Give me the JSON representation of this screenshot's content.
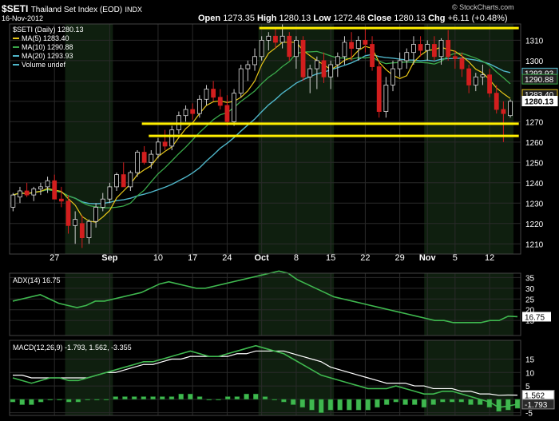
{
  "header": {
    "symbol": "$SETI",
    "name": "Thailand Set Index (EOD)",
    "type": "INDX",
    "date": "16-Nov-2012",
    "open_label": "Open",
    "open": "1273.35",
    "high_label": "High",
    "high": "1280.13",
    "low_label": "Low",
    "low": "1272.48",
    "close_label": "Close",
    "close": "1280.13",
    "chg_label": "Chg",
    "chg": "+6.11 (+0.48%)",
    "watermark": "© StockCharts.com"
  },
  "colors": {
    "up": "#2db84a",
    "down": "#d21e1e",
    "ma5": "#e6c619",
    "ma10": "#3aa84a",
    "ma20": "#4fb6c9",
    "trendline": "#ffef00",
    "adx": "#3fb84f",
    "macd": "#3fb84f",
    "signal": "#ffffff",
    "hist": "#3fb84f",
    "grid": "#2a2a2a",
    "shade": "#0f1f0f"
  },
  "chart_data": [
    {
      "type": "candlestick",
      "title": "$SETI (Daily) 1280.13",
      "legend": [
        {
          "name": "MA(5) 1283.40",
          "color": "ma5"
        },
        {
          "name": "MA(10) 1290.88",
          "color": "ma10"
        },
        {
          "name": "MA(20) 1293.93",
          "color": "ma20"
        },
        {
          "name": "Volume undef",
          "color": "ma20"
        }
      ],
      "legend_position": "top-left",
      "grid": true,
      "ylim": [
        1205,
        1318
      ],
      "yticks": [
        1210,
        1220,
        1230,
        1240,
        1250,
        1260,
        1270,
        1280,
        1290,
        1300,
        1310
      ],
      "price_labels": [
        "1293.93",
        "1290.88",
        "1283.40",
        "1280.13"
      ],
      "xticks": [
        {
          "label": "27",
          "i": 6
        },
        {
          "label": "Sep",
          "i": 14
        },
        {
          "label": "10",
          "i": 21
        },
        {
          "label": "17",
          "i": 26
        },
        {
          "label": "24",
          "i": 31
        },
        {
          "label": "Oct",
          "i": 36
        },
        {
          "label": "8",
          "i": 41
        },
        {
          "label": "15",
          "i": 46
        },
        {
          "label": "22",
          "i": 51
        },
        {
          "label": "29",
          "i": 56
        },
        {
          "label": "Nov",
          "i": 60
        },
        {
          "label": "5",
          "i": 64
        },
        {
          "label": "12",
          "i": 69
        }
      ],
      "shade_ranges": [
        [
          8,
          14
        ],
        [
          36,
          46
        ],
        [
          60,
          72
        ]
      ],
      "n": 74,
      "ohlc": [
        [
          1228,
          1235,
          1226,
          1234
        ],
        [
          1233,
          1238,
          1230,
          1236
        ],
        [
          1236,
          1240,
          1233,
          1234
        ],
        [
          1234,
          1238,
          1231,
          1237
        ],
        [
          1237,
          1240,
          1234,
          1238
        ],
        [
          1238,
          1243,
          1235,
          1241
        ],
        [
          1241,
          1244,
          1236,
          1232
        ],
        [
          1232,
          1238,
          1228,
          1231
        ],
        [
          1231,
          1234,
          1215,
          1219
        ],
        [
          1219,
          1226,
          1210,
          1222
        ],
        [
          1220,
          1224,
          1208,
          1213
        ],
        [
          1213,
          1222,
          1210,
          1221
        ],
        [
          1221,
          1230,
          1218,
          1228
        ],
        [
          1228,
          1235,
          1226,
          1232
        ],
        [
          1232,
          1240,
          1230,
          1238
        ],
        [
          1238,
          1245,
          1236,
          1244
        ],
        [
          1244,
          1250,
          1240,
          1238
        ],
        [
          1238,
          1246,
          1236,
          1245
        ],
        [
          1245,
          1256,
          1243,
          1255
        ],
        [
          1255,
          1258,
          1249,
          1250
        ],
        [
          1250,
          1256,
          1247,
          1254
        ],
        [
          1254,
          1262,
          1252,
          1260
        ],
        [
          1260,
          1266,
          1256,
          1258
        ],
        [
          1258,
          1268,
          1256,
          1266
        ],
        [
          1266,
          1275,
          1264,
          1273
        ],
        [
          1273,
          1278,
          1270,
          1276
        ],
        [
          1276,
          1279,
          1271,
          1274
        ],
        [
          1274,
          1283,
          1272,
          1281
        ],
        [
          1281,
          1288,
          1278,
          1286
        ],
        [
          1286,
          1290,
          1280,
          1282
        ],
        [
          1282,
          1286,
          1276,
          1278
        ],
        [
          1278,
          1283,
          1268,
          1270
        ],
        [
          1270,
          1286,
          1268,
          1284
        ],
        [
          1284,
          1298,
          1282,
          1296
        ],
        [
          1296,
          1300,
          1290,
          1298
        ],
        [
          1298,
          1306,
          1295,
          1302
        ],
        [
          1302,
          1312,
          1300,
          1310
        ],
        [
          1310,
          1314,
          1305,
          1312
        ],
        [
          1312,
          1316,
          1306,
          1309
        ],
        [
          1309,
          1318,
          1306,
          1312
        ],
        [
          1312,
          1314,
          1300,
          1302
        ],
        [
          1302,
          1312,
          1296,
          1310
        ],
        [
          1310,
          1312,
          1290,
          1292
        ],
        [
          1292,
          1298,
          1284,
          1296
        ],
        [
          1296,
          1302,
          1286,
          1300
        ],
        [
          1300,
          1304,
          1289,
          1292
        ],
        [
          1292,
          1300,
          1286,
          1298
        ],
        [
          1298,
          1304,
          1292,
          1302
        ],
        [
          1302,
          1312,
          1298,
          1309
        ],
        [
          1309,
          1314,
          1300,
          1306
        ],
        [
          1306,
          1312,
          1300,
          1310
        ],
        [
          1310,
          1316,
          1304,
          1308
        ],
        [
          1308,
          1312,
          1295,
          1297
        ],
        [
          1297,
          1300,
          1272,
          1275
        ],
        [
          1275,
          1292,
          1272,
          1288
        ],
        [
          1288,
          1300,
          1285,
          1296
        ],
        [
          1296,
          1304,
          1292,
          1300
        ],
        [
          1300,
          1306,
          1296,
          1304
        ],
        [
          1304,
          1312,
          1298,
          1308
        ],
        [
          1308,
          1312,
          1302,
          1305
        ],
        [
          1305,
          1310,
          1300,
          1308
        ],
        [
          1308,
          1312,
          1300,
          1302
        ],
        [
          1302,
          1311,
          1298,
          1310
        ],
        [
          1310,
          1315,
          1300,
          1302
        ],
        [
          1302,
          1305,
          1296,
          1301
        ],
        [
          1301,
          1304,
          1292,
          1296
        ],
        [
          1296,
          1298,
          1284,
          1288
        ],
        [
          1288,
          1294,
          1285,
          1292
        ],
        [
          1292,
          1298,
          1288,
          1293
        ],
        [
          1293,
          1296,
          1282,
          1284
        ],
        [
          1284,
          1288,
          1274,
          1276
        ],
        [
          1276,
          1280,
          1260,
          1274
        ],
        [
          1273,
          1281,
          1272,
          1280
        ]
      ],
      "trendlines": [
        {
          "y": 1316,
          "from": 36,
          "to": 73
        },
        {
          "y": 1269,
          "from": 19,
          "to": 73
        },
        {
          "y": 1263,
          "from": 20,
          "to": 73
        }
      ]
    },
    {
      "type": "line",
      "title": "ADX(14) 16.75",
      "series": [
        {
          "name": "ADX(14)",
          "values": [
            24,
            25,
            26,
            27,
            25,
            23,
            22,
            21,
            22,
            24,
            24,
            25,
            26,
            27,
            28,
            30,
            32,
            33,
            32,
            31,
            30,
            30,
            31,
            32,
            33,
            34,
            35,
            36,
            37,
            38,
            37,
            34,
            32,
            30,
            28,
            26,
            25,
            24,
            23,
            22,
            21,
            20,
            19,
            18,
            17,
            16,
            15,
            15,
            14,
            14,
            14,
            14,
            15,
            15,
            17,
            16.75
          ]
        }
      ],
      "ylim": [
        8,
        37
      ],
      "yticks": [
        15,
        20,
        25,
        30,
        35
      ],
      "last_label": "16.75"
    },
    {
      "type": "line",
      "title": "MACD(12,26,9) -1.793, 1.562, -3.355",
      "series": [
        {
          "name": "MACD",
          "values": [
            8,
            7,
            6,
            7,
            8,
            8,
            7,
            7,
            8,
            9,
            10,
            11,
            12,
            13,
            14,
            14,
            15,
            16,
            17,
            18,
            17,
            16,
            16,
            17,
            18,
            19,
            20,
            19,
            18,
            17,
            15,
            13,
            11,
            9,
            8,
            7,
            6,
            5,
            4,
            4,
            4,
            5,
            4,
            3,
            2,
            2,
            3,
            3,
            2,
            1,
            0,
            -1,
            -3,
            -2.5,
            -1.793
          ]
        },
        {
          "name": "Signal",
          "values": [
            9,
            9,
            8,
            8,
            8,
            8,
            8,
            8,
            8,
            9,
            10,
            10,
            11,
            12,
            13,
            13,
            14,
            15,
            15,
            16,
            16,
            16,
            16,
            16,
            17,
            17,
            18,
            18,
            18,
            18,
            17,
            16,
            15,
            14,
            12,
            11,
            10,
            9,
            8,
            7,
            6,
            6,
            6,
            5,
            5,
            4,
            4,
            4,
            3,
            3,
            2,
            2,
            1.5,
            1.6,
            1.562
          ]
        }
      ],
      "histogram": [
        -1,
        -2,
        -2,
        -1,
        0,
        0,
        -1,
        -1,
        0,
        0,
        0,
        1,
        1,
        1,
        1,
        1,
        1,
        1,
        2,
        2,
        1,
        0,
        0,
        1,
        1,
        2,
        2,
        1,
        0,
        -1,
        -2,
        -3,
        -4,
        -5,
        -4,
        -4,
        -4,
        -4,
        -4,
        -3,
        -2,
        -1,
        -2,
        -2,
        -3,
        -2,
        -1,
        -1,
        -1,
        -2,
        -2,
        -3,
        -4.5,
        -4,
        -3.355
      ],
      "ylim": [
        -6,
        22
      ],
      "yticks": [
        -5,
        0,
        5,
        10,
        15
      ],
      "last_labels": [
        "1.562",
        "-1.793"
      ]
    }
  ]
}
